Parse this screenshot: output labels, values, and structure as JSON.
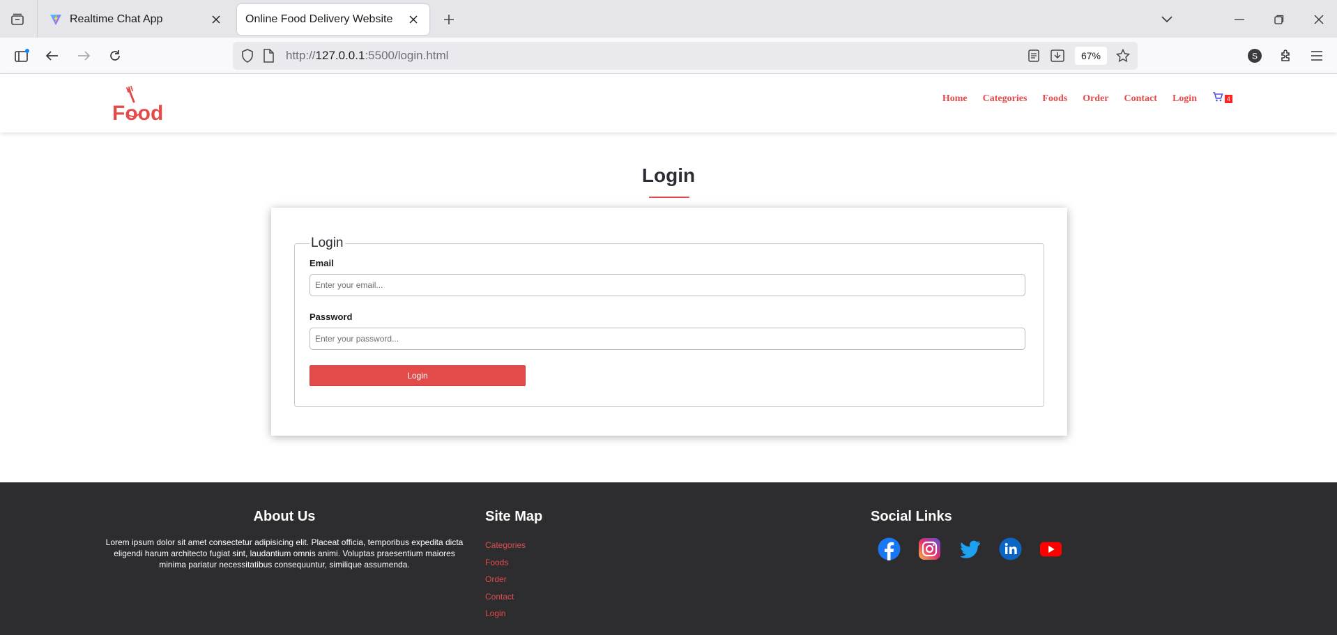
{
  "browser": {
    "tabs": [
      {
        "title": "Realtime Chat App",
        "favicon": "vite-logo-icon",
        "active": false
      },
      {
        "title": "Online Food Delivery Website",
        "favicon": "none",
        "active": true
      }
    ],
    "url": {
      "scheme": "http://",
      "host": "127.0.0.1",
      "rest": ":5500/login.html"
    },
    "zoom": "67%"
  },
  "site": {
    "logo_text": "Food",
    "nav": [
      "Home",
      "Categories",
      "Foods",
      "Order",
      "Contact",
      "Login"
    ],
    "cart_count": "4"
  },
  "main": {
    "heading": "Login",
    "form": {
      "legend": "Login",
      "email_label": "Email",
      "email_placeholder": "Enter your email...",
      "password_label": "Password",
      "password_placeholder": "Enter your password...",
      "submit_label": "Login"
    }
  },
  "footer": {
    "about": {
      "title": "About Us",
      "text": "Lorem ipsum dolor sit amet consectetur adipisicing elit. Placeat officia, temporibus expedita dicta eligendi harum architecto fugiat sint, laudantium omnis animi. Voluptas praesentium maiores minima pariatur necessitatibus consequuntur, similique assumenda."
    },
    "sitemap": {
      "title": "Site Map",
      "links": [
        "Categories",
        "Foods",
        "Order",
        "Contact",
        "Login"
      ]
    },
    "social": {
      "title": "Social Links",
      "icons": [
        "facebook-icon",
        "instagram-icon",
        "twitter-icon",
        "linkedin-icon",
        "youtube-icon"
      ]
    }
  },
  "colors": {
    "accent": "#e34b4b",
    "footer_bg": "#2d2d2f",
    "facebook": "#1877f2",
    "twitter": "#1da1f2",
    "linkedin": "#0a66c2",
    "youtube": "#ff0000"
  }
}
